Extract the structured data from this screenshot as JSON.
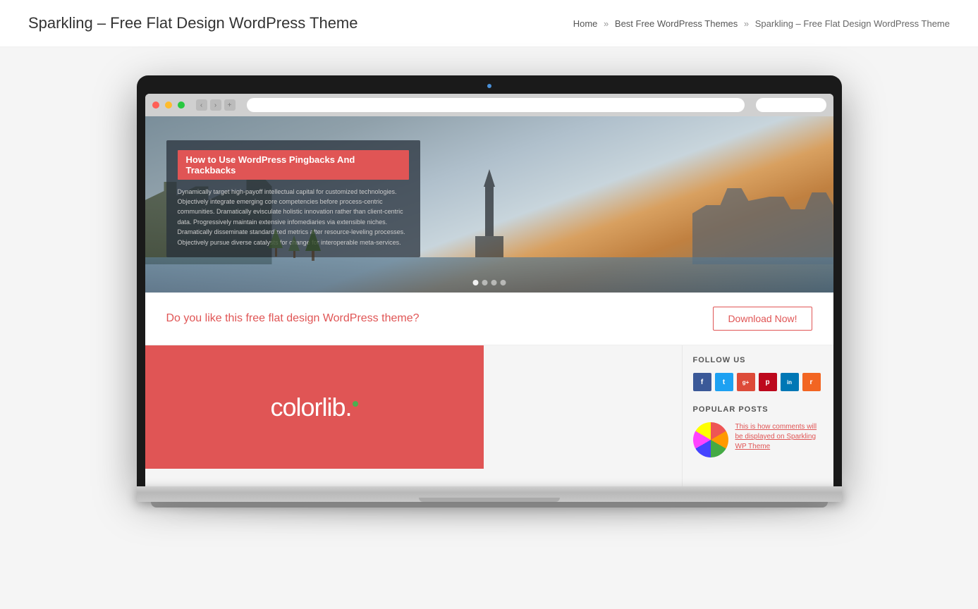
{
  "header": {
    "title": "Sparkling – Free Flat Design WordPress Theme",
    "breadcrumb": {
      "home": "Home",
      "separator1": "»",
      "section": "Best Free WordPress Themes",
      "separator2": "»",
      "current": "Sparkling – Free Flat Design WordPress Theme"
    }
  },
  "browser": {
    "dots": [
      "red",
      "yellow",
      "green"
    ],
    "camera": "camera"
  },
  "hero": {
    "badge": "How to Use WordPress Pingbacks And Trackbacks",
    "body_text": "Dynamically target high-payoff intellectual capital for customized technologies. Objectively integrate emerging core competencies before process-centric communities. Dramatically evisculate holistic innovation rather than client-centric data. Progressively maintain extensive infomediaries via extensible niches. Dramatically disseminate standardized metrics after resource-leveling processes. Objectively pursue diverse catalysts for change for interoperable meta-services.",
    "dots": [
      "active",
      "",
      "",
      ""
    ]
  },
  "download": {
    "cta_text": "Do you like this free flat design WordPress theme?",
    "button_label": "Download Now!"
  },
  "blog": {
    "logo_text": "colorlib.",
    "logo_dot_color": "#4caf50"
  },
  "sidebar": {
    "follow_us_label": "FOLLOW US",
    "social_icons": [
      {
        "name": "facebook",
        "letter": "f"
      },
      {
        "name": "twitter",
        "letter": "t"
      },
      {
        "name": "google-plus",
        "letter": "g+"
      },
      {
        "name": "pinterest",
        "letter": "p"
      },
      {
        "name": "linkedin",
        "letter": "in"
      },
      {
        "name": "rss",
        "letter": "r"
      }
    ],
    "popular_posts_label": "POPULAR POSTS",
    "popular_posts": [
      {
        "title": "This is how comments will be displayed on Sparkling WP Theme",
        "thumbnail": "colorlib-circle"
      }
    ]
  }
}
